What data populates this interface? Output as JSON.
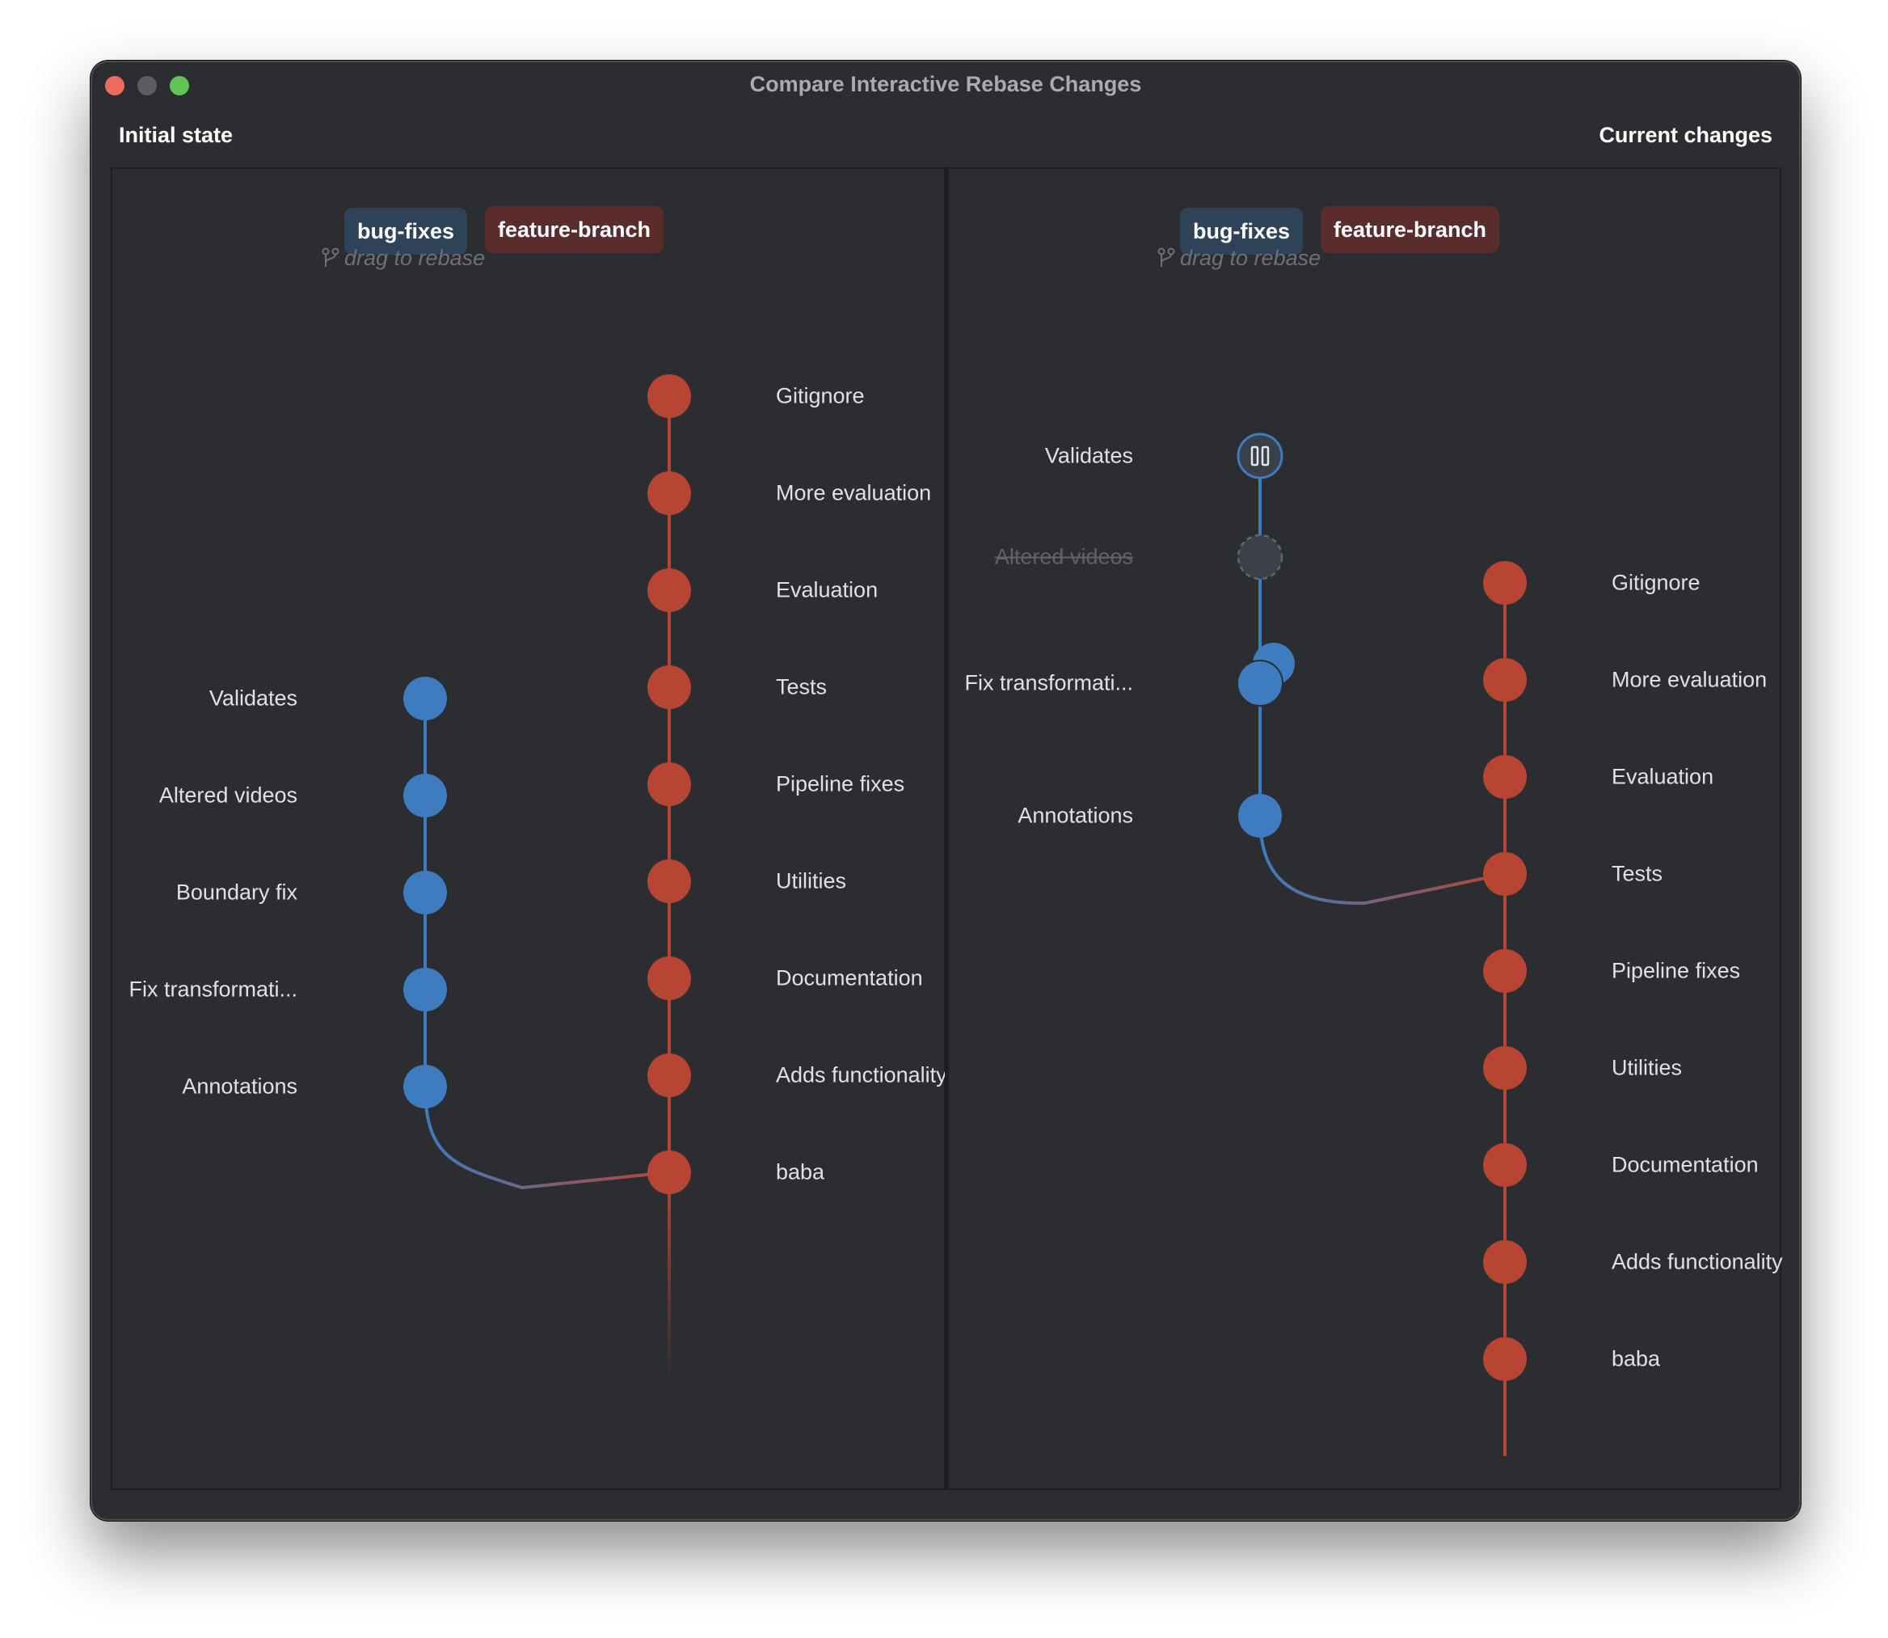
{
  "window": {
    "title": "Compare Interactive Rebase Changes"
  },
  "sections": {
    "left": "Initial state",
    "right": "Current changes"
  },
  "colors": {
    "background": "#2b2d31",
    "bug_fixes_node": "#3e7bbf",
    "feature_branch_node": "#b64534",
    "bug_fixes_tag": "#2e4358",
    "feature_branch_tag": "#5a2d2d"
  },
  "branches": {
    "bug_fixes": "bug-fixes",
    "feature_branch": "feature-branch",
    "drag_hint": "drag to rebase",
    "drag_hint_icon": "branch-icon"
  },
  "initial": {
    "feature_commits": [
      "Gitignore",
      "More evaluation",
      "Evaluation",
      "Tests",
      "Pipeline fixes",
      "Utilities",
      "Documentation",
      "Adds functionality",
      "baba"
    ],
    "bug_commits": [
      "Validates",
      "Altered videos",
      "Boundary fix",
      "Fix transformati...",
      "Annotations"
    ],
    "bug_base": "baba"
  },
  "current": {
    "feature_commits": [
      "Gitignore",
      "More evaluation",
      "Evaluation",
      "Tests",
      "Pipeline fixes",
      "Utilities",
      "Documentation",
      "Adds functionality",
      "baba"
    ],
    "bug_commits": [
      {
        "label": "Validates",
        "state": "paused",
        "icon": "pause-icon"
      },
      {
        "label": "Altered videos",
        "state": "dropped"
      },
      {
        "label": "Fix transformati...",
        "state": "squashed"
      },
      {
        "label": "Annotations",
        "state": "normal"
      }
    ],
    "bug_base": "Tests"
  }
}
